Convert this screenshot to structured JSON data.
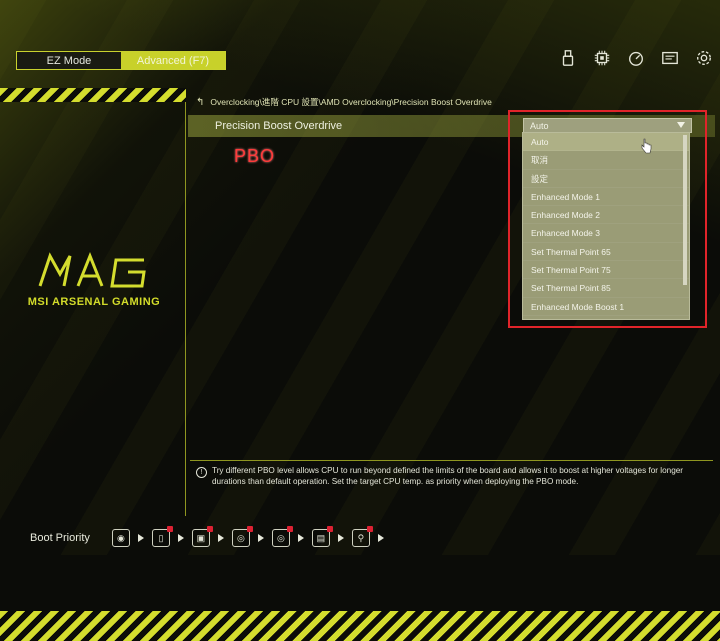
{
  "modes": {
    "ez": "EZ Mode",
    "advanced": "Advanced (F7)"
  },
  "icons": [
    "usb-icon",
    "cpu-icon",
    "gauge-icon",
    "board-explorer-icon",
    "settings-icon"
  ],
  "brand": {
    "name": "MSI ARSENAL GAMING",
    "logo_text": "MAG",
    "accent": "#d4dd2e"
  },
  "breadcrumb": "Overclocking\\進階 CPU 設置\\AMD Overclocking\\Precision Boost Overdrive",
  "setting": {
    "label": "Precision Boost Overdrive",
    "value": "Auto"
  },
  "annotation": {
    "text": "PBO",
    "color": "#ff3b3b"
  },
  "dropdown": {
    "options": [
      "Auto",
      "取消",
      "設定",
      "Enhanced Mode 1",
      "Enhanced Mode 2",
      "Enhanced Mode 3",
      "Set Thermal Point 65",
      "Set Thermal Point 75",
      "Set Thermal Point 85",
      "Enhanced Mode Boost 1"
    ],
    "selected_index": 0
  },
  "help": "Try different PBO level allows CPU to run beyond defined the limits of the board and allows it to boost at higher voltages for longer durations than default operation. Set the target CPU temp. as priority when deploying the PBO mode.",
  "boot": {
    "label": "Boot Priority"
  }
}
